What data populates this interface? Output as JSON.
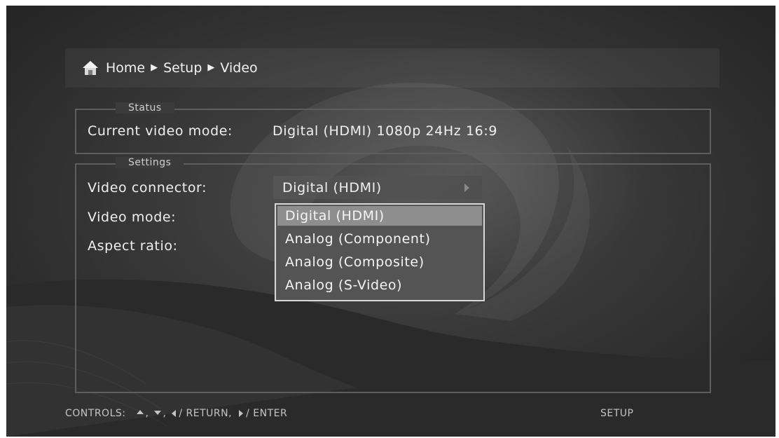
{
  "breadcrumb": {
    "items": [
      "Home",
      "Setup",
      "Video"
    ]
  },
  "status": {
    "legend": "Status",
    "current_mode_label": "Current video mode:",
    "current_mode_value": "Digital (HDMI) 1080p 24Hz 16:9"
  },
  "settings": {
    "legend": "Settings",
    "video_connector_label": "Video connector:",
    "video_connector_value": "Digital (HDMI)",
    "video_mode_label": "Video mode:",
    "aspect_ratio_label": "Aspect ratio:"
  },
  "dropdown": {
    "selected": "Digital (HDMI)",
    "options": [
      "Digital (HDMI)",
      "Analog (Component)",
      "Analog (Composite)",
      "Analog (S-Video)"
    ]
  },
  "footer": {
    "controls_label": "CONTROLS:",
    "return_label": "/ RETURN,",
    "enter_label": "/ ENTER",
    "context": "SETUP"
  },
  "icons": {
    "home": "home-icon",
    "breadcrumb_separator": "chevron-right-icon",
    "select_arrow": "arrow-right-icon"
  },
  "colors": {
    "background": "#363636",
    "text": "#f0f0f0",
    "highlight": "#8e8e8e",
    "dropdown_border": "#d8d8d8"
  }
}
